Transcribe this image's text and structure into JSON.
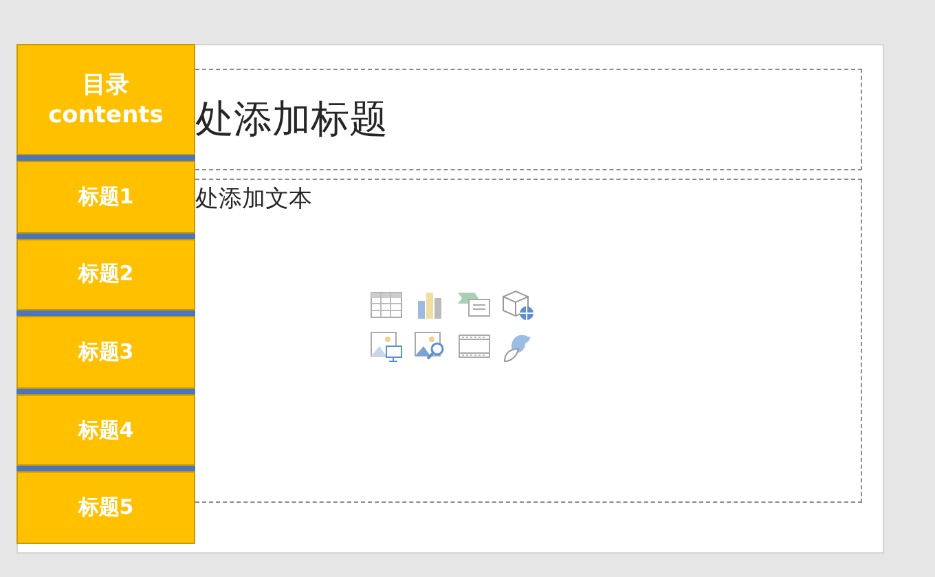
{
  "slide": {
    "title_placeholder": "处添加标题",
    "body_placeholder": "处添加文本"
  },
  "nav": {
    "header": {
      "title": "目录",
      "subtitle": "contents"
    },
    "items": [
      {
        "label": "标题1"
      },
      {
        "label": "标题2"
      },
      {
        "label": "标题3"
      },
      {
        "label": "标题4"
      },
      {
        "label": "标题5"
      }
    ]
  }
}
